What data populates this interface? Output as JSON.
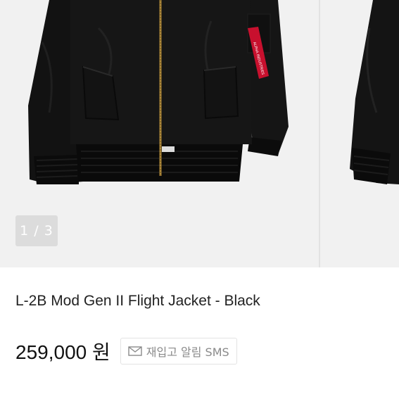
{
  "gallery": {
    "counter": "1 / 3",
    "tag_text": "ALPHA INDUSTRIES"
  },
  "product": {
    "title": "L-2B Mod Gen II Flight Jacket - Black",
    "price": "259,000 원",
    "restock_label": "재입고 알림 SMS",
    "restock_icon": "mail-icon"
  },
  "colors": {
    "jacket": "#141414",
    "tag": "#c8102e",
    "zipper": "#b08a3a"
  }
}
